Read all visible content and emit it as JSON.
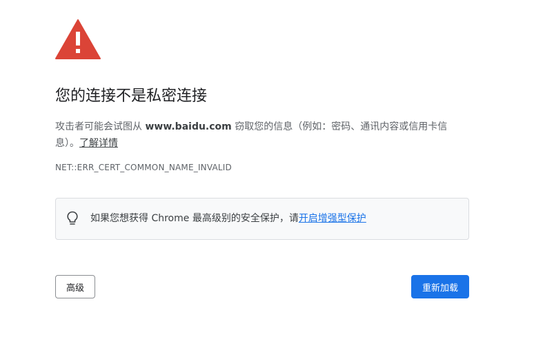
{
  "header": {
    "icon": "warning-triangle-icon",
    "icon_color": "#db4437",
    "title": "您的连接不是私密连接"
  },
  "description": {
    "prefix": "攻击者可能会试图从 ",
    "domain": "www.baidu.com",
    "suffix": " 窃取您的信息（例如：密码、通讯内容或信用卡信息）。",
    "learn_more": "了解详情"
  },
  "error_code": "NET::ERR_CERT_COMMON_NAME_INVALID",
  "info_box": {
    "icon": "lightbulb-icon",
    "text": "如果您想获得 Chrome 最高级别的安全保护，请",
    "link": "开启增强型保护"
  },
  "buttons": {
    "advanced_label": "高级",
    "reload_label": "重新加载",
    "accent_color": "#1a73e8"
  }
}
